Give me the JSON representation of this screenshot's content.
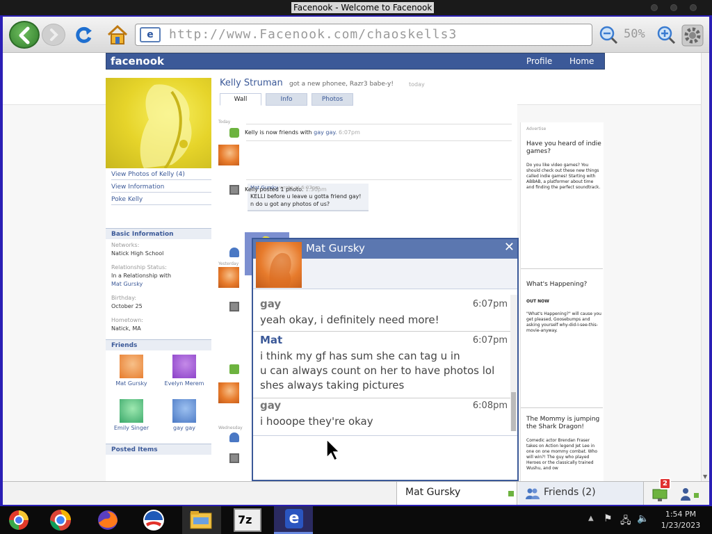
{
  "window": {
    "title": "Facenook - Welcome to Facenook"
  },
  "browser": {
    "url": "http://www.Facenook.com/chaoskells3",
    "zoom": "50%",
    "page_icon_letter": "e"
  },
  "site": {
    "logo": "facenook",
    "nav": [
      "Profile",
      "Home"
    ]
  },
  "profile": {
    "name": "Kelly Struman",
    "status": "got a new phonee, Razr3 babe-y!",
    "status_time": "today",
    "tabs": [
      "Wall",
      "Info",
      "Photos"
    ],
    "active_tab": "Wall",
    "left_links": [
      "View Photos of Kelly (4)",
      "View Information",
      "Poke Kelly"
    ],
    "basic_info": {
      "header": "Basic Information",
      "fields": [
        {
          "label": "Networks:",
          "value": "Natick High School"
        },
        {
          "label": "Relationship Status:",
          "value": "In a Relationship with",
          "value2": "Mat Gursky"
        },
        {
          "label": "Birthday:",
          "value": "October 25"
        },
        {
          "label": "Hometown:",
          "value": "Natick, MA"
        }
      ]
    },
    "friends": {
      "header": "Friends",
      "list": [
        {
          "name": "Mat Gursky",
          "color": "#e77b2c"
        },
        {
          "name": "Evelyn Merem",
          "color": "#8a3fc8"
        },
        {
          "name": "Emily Singer",
          "color": "#3aa86a"
        },
        {
          "name": "gay gay",
          "color": "#4a78c4"
        }
      ]
    },
    "posted_items": "Posted Items"
  },
  "feed": {
    "day_labels": [
      "Today",
      "Yesterday",
      "Wednesday"
    ],
    "items": {
      "friends": {
        "text": "Kelly is now friends with",
        "link": "gay gay.",
        "time": "6:07pm"
      },
      "comment": {
        "author": "Mat Gursky",
        "meta": "wrote at",
        "time": "6:07pm",
        "line1": "KELLI before u leave u gotta friend gay!",
        "line2": "n do u got any photos of us?"
      },
      "photo": {
        "text": "Kelly posted 1 photo.",
        "time": "1:50pm"
      }
    }
  },
  "ads": {
    "header": "Advertise",
    "items": [
      {
        "title": "Have you heard of indie games?",
        "body": "Do you like video games? You should check out these new things called indie games! Starting with ABBAB, a platformer about time and finding the perfect soundtrack."
      },
      {
        "title": "What's Happening?",
        "subtitle": "OUT NOW",
        "body": "\"What's Happening?\" will cause you get pleased, Goosebumps and asking yourself why-did-I-see-this-movie-anyway."
      },
      {
        "title": "The Mommy is jumping the Shark Dragon!",
        "body": "Comedic actor Brendan Fraser takes on Action legend Jet Lee in one on one mommy combat. Who will win?! The guy who played Heroes or the classically trained Wushu, and ow"
      }
    ]
  },
  "chat": {
    "contact": "Mat Gursky",
    "messages": [
      {
        "from": "gay",
        "time": "6:07pm",
        "lines": [
          "yeah okay, i definitely need more!"
        ]
      },
      {
        "from": "Mat",
        "time": "6:07pm",
        "lines": [
          "i think my gf has sum she can tag u in",
          "u can always count on her to have photos lol",
          "shes always taking pictures"
        ]
      },
      {
        "from": "gay",
        "time": "6:08pm",
        "lines": [
          "i hooope they're okay"
        ]
      }
    ]
  },
  "chatbar": {
    "chat_tab": "Mat Gursky",
    "friends_tab": "Friends (2)",
    "notification_count": "2"
  },
  "taskbar": {
    "time": "1:54 PM",
    "date": "1/23/2023",
    "apps": [
      "chrome-old",
      "chrome",
      "firefox",
      "obama-app",
      "file-explorer",
      "7zip",
      "facenook-browser"
    ]
  },
  "colors": {
    "brand": "#3b5998",
    "frame": "#2b1fb5",
    "accent_green": "#6db33f"
  }
}
